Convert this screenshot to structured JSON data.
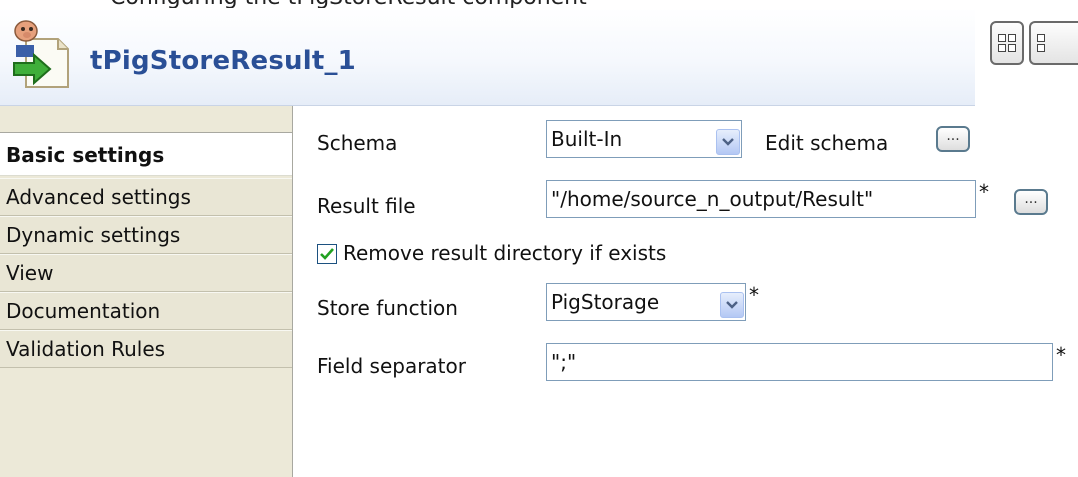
{
  "top_caption": "Configuring the tPigStoreResult component",
  "component": {
    "title": "tPigStoreResult_1",
    "icon": "pig-store-result-icon"
  },
  "view_toggles": [
    "grid-view-icon",
    "grid-view-icon"
  ],
  "tabs": [
    {
      "label": "Basic settings",
      "active": true
    },
    {
      "label": "Advanced settings",
      "active": false
    },
    {
      "label": "Dynamic settings",
      "active": false
    },
    {
      "label": "View",
      "active": false
    },
    {
      "label": "Documentation",
      "active": false
    },
    {
      "label": "Validation Rules",
      "active": false
    }
  ],
  "form": {
    "schema_label": "Schema",
    "schema_value": "Built-In",
    "edit_schema_label": "Edit schema",
    "result_file_label": "Result file",
    "result_file_value": "\"/home/source_n_output/Result\"",
    "remove_dir_label": "Remove result directory if exists",
    "remove_dir_checked": true,
    "store_function_label": "Store function",
    "store_function_value": "PigStorage",
    "field_separator_label": "Field separator",
    "field_separator_value": "\";\"",
    "required_marker": "*",
    "browse_label": "..."
  }
}
